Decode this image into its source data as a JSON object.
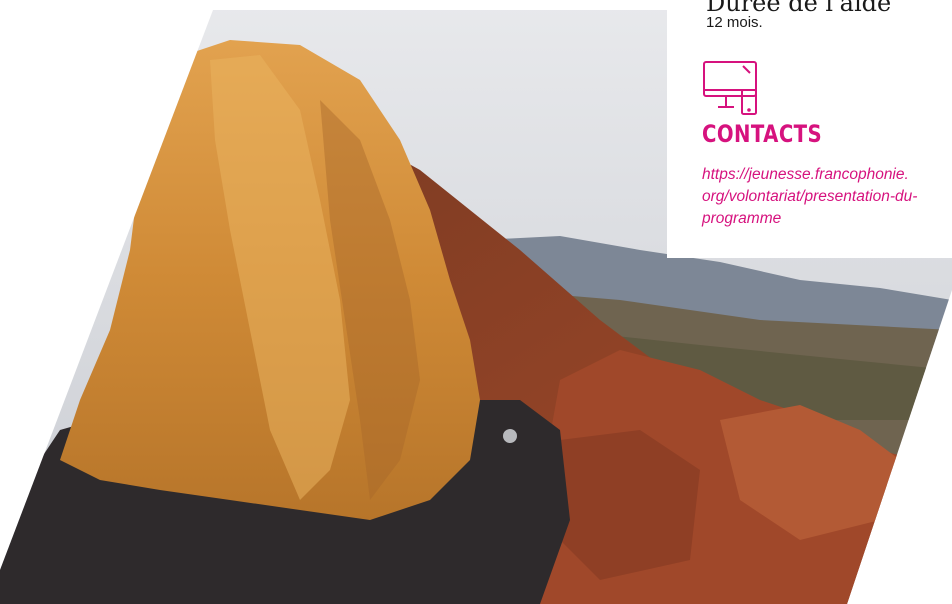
{
  "duree": {
    "title": "Durée de l'aide",
    "value": "12 mois."
  },
  "contacts": {
    "icon": "computer-icon",
    "title": "CONTACTS",
    "url_lines": [
      "https://jeunesse.francophonie.",
      "org/volontariat/presentation-du-",
      "programme"
    ]
  },
  "colors": {
    "accent": "#d6127e",
    "text": "#1a1a1a"
  },
  "photo": {
    "subject": "photo-woman-hair-mountains"
  }
}
